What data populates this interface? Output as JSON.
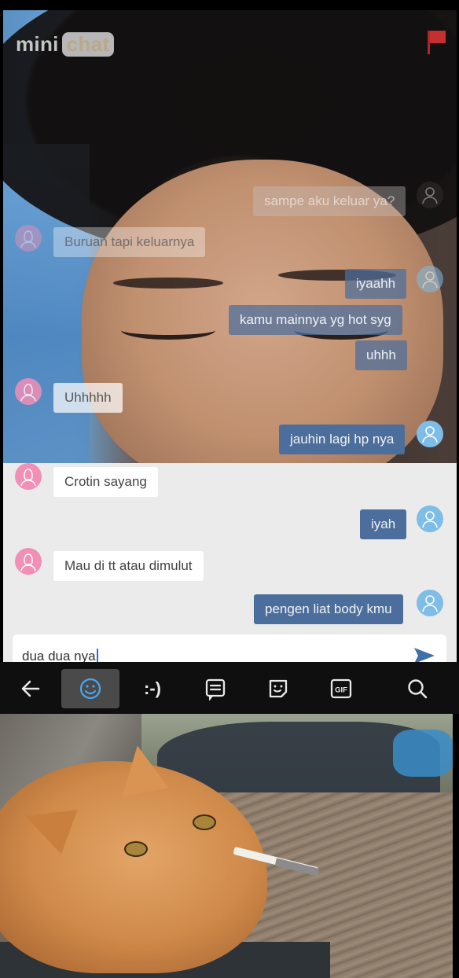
{
  "app": {
    "logo_left": "mini",
    "logo_right": "chat"
  },
  "messages": [
    {
      "id": "m1",
      "dir": "out",
      "text": "sampe aku keluar ya?"
    },
    {
      "id": "m2",
      "dir": "in",
      "text": "Buruan tapi keluarnya"
    },
    {
      "id": "m3",
      "dir": "out",
      "text": "iyaahh"
    },
    {
      "id": "m4",
      "dir": "out",
      "text": "kamu mainnya yg hot syg"
    },
    {
      "id": "m5",
      "dir": "out",
      "text": "uhhh"
    },
    {
      "id": "m6",
      "dir": "in",
      "text": "Uhhhhh"
    },
    {
      "id": "m7",
      "dir": "out",
      "text": "jauhin lagi hp nya"
    },
    {
      "id": "m8",
      "dir": "in",
      "text": "Crotin sayang"
    },
    {
      "id": "m9",
      "dir": "out",
      "text": "iyah"
    },
    {
      "id": "m10",
      "dir": "in",
      "text": "Mau di tt atau dimulut"
    },
    {
      "id": "m11",
      "dir": "out",
      "text": "pengen liat body kmu"
    }
  ],
  "input": {
    "value": "dua dua nya"
  },
  "keyboard_toolbar": {
    "items": [
      {
        "name": "back-arrow-icon"
      },
      {
        "name": "emoji-icon",
        "active": true
      },
      {
        "name": "emoticon-text-icon",
        "label": ":-)"
      },
      {
        "name": "clipboard-icon"
      },
      {
        "name": "sticker-icon"
      },
      {
        "name": "gif-icon",
        "label": "GIF"
      },
      {
        "name": "search-icon"
      }
    ]
  },
  "colors": {
    "outgoing_bubble": "#4b6e9c",
    "incoming_bubble": "#ffffff",
    "female_avatar": "#f28fb6",
    "male_avatar": "#7dbde7",
    "chat_panel_bg": "#ebebeb",
    "flag": "#c43030"
  }
}
